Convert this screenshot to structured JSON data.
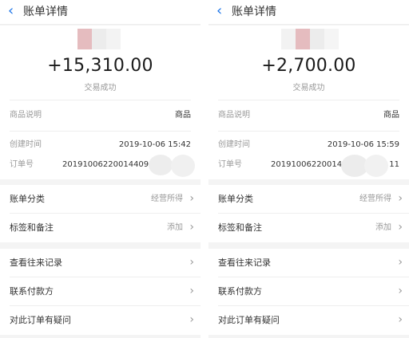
{
  "screens": [
    {
      "nav": {
        "back_icon": "‹",
        "title": "账单详情"
      },
      "hero": {
        "amount": "+15,310.00",
        "status": "交易成功"
      },
      "details": {
        "product_label": "商品说明",
        "product_value": "商品",
        "created_label": "创建时间",
        "created_value": "2019-10-06 15:42",
        "order_label": "订单号",
        "order_value": "20191006220014409"
      },
      "group1": [
        {
          "label": "账单分类",
          "value": "经营所得",
          "chevron": "›"
        },
        {
          "label": "标签和备注",
          "value": "添加",
          "chevron": "›"
        }
      ],
      "group2": [
        {
          "label": "查看往来记录",
          "chevron": "›"
        },
        {
          "label": "联系付款方",
          "chevron": "›"
        },
        {
          "label": "对此订单有疑问",
          "chevron": "›"
        }
      ]
    },
    {
      "nav": {
        "back_icon": "‹",
        "title": "账单详情"
      },
      "hero": {
        "amount": "+2,700.00",
        "status": "交易成功"
      },
      "details": {
        "product_label": "商品说明",
        "product_value": "商品",
        "created_label": "创建时间",
        "created_value": "2019-10-06 15:59",
        "order_label": "订单号",
        "order_value": "20191006220014410",
        "order_suffix": "11"
      },
      "group1": [
        {
          "label": "账单分类",
          "value": "经营所得",
          "chevron": "›"
        },
        {
          "label": "标签和备注",
          "value": "添加",
          "chevron": "›"
        }
      ],
      "group2": [
        {
          "label": "查看往来记录",
          "chevron": "›"
        },
        {
          "label": "联系付款方",
          "chevron": "›"
        },
        {
          "label": "对此订单有疑问",
          "chevron": "›"
        }
      ]
    }
  ],
  "colors": {
    "accent": "#1a73e8",
    "muted": "#999999",
    "text": "#333333",
    "bg": "#f4f4f4",
    "avatar_pink": "#e5bcbf",
    "avatar_gray": "#ececec"
  }
}
